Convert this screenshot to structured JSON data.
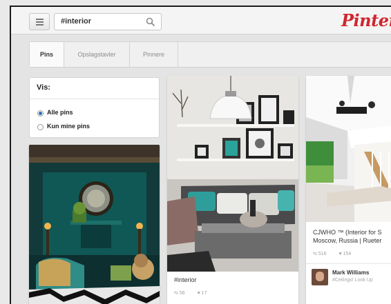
{
  "header": {
    "search_value": "#interior",
    "logo_text": "Pinterest",
    "icons": {
      "menu": "menu-icon",
      "search": "search-icon"
    },
    "brand_color": "#d0262e"
  },
  "tabs": [
    {
      "label": "Pins",
      "active": true
    },
    {
      "label": "Opslagstavler",
      "active": false
    },
    {
      "label": "Pinnere",
      "active": false
    }
  ],
  "filter": {
    "title": "Vis:",
    "options": [
      {
        "label": "Alle pins",
        "checked": true
      },
      {
        "label": "Kun mine pins",
        "checked": false
      }
    ]
  },
  "pins": [
    {
      "caption": "#interior",
      "repins": "56",
      "likes": "17"
    },
    {
      "caption_line1": "CJWHO ™ (Interior for S",
      "caption_line2": "Moscow, Russia | Rueter",
      "repins": "516",
      "likes": "154",
      "pinner_name": "Mark Williams",
      "pinner_board": "#Ceilings! Look Up"
    }
  ]
}
